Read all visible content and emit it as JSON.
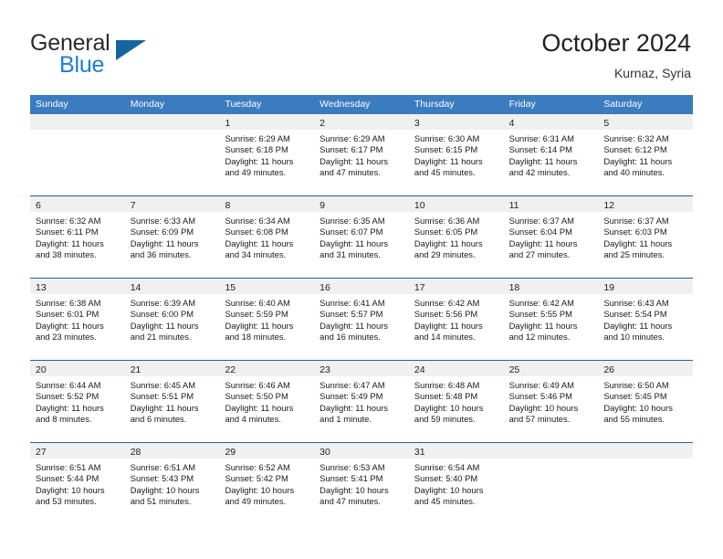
{
  "brand": {
    "name_primary": "General",
    "name_secondary": "Blue",
    "mark": "triangle-logo",
    "colors": {
      "primary_text": "#2b2b2b",
      "secondary_text": "#1b7fd4",
      "mark": "#15659e"
    }
  },
  "header": {
    "title": "October 2024",
    "subtitle": "Kurnaz, Syria"
  },
  "theme": {
    "header_row_bg": "#3b7cc0",
    "row_divider": "#2a6099",
    "day_band_bg": "#f0f0f0",
    "cell_bg": "#ffffff"
  },
  "calendar": {
    "weekdays": [
      "Sunday",
      "Monday",
      "Tuesday",
      "Wednesday",
      "Thursday",
      "Friday",
      "Saturday"
    ],
    "weeks": [
      [
        {
          "day": "",
          "lines": []
        },
        {
          "day": "",
          "lines": []
        },
        {
          "day": "1",
          "lines": [
            "Sunrise: 6:29 AM",
            "Sunset: 6:18 PM",
            "Daylight: 11 hours",
            "and 49 minutes."
          ]
        },
        {
          "day": "2",
          "lines": [
            "Sunrise: 6:29 AM",
            "Sunset: 6:17 PM",
            "Daylight: 11 hours",
            "and 47 minutes."
          ]
        },
        {
          "day": "3",
          "lines": [
            "Sunrise: 6:30 AM",
            "Sunset: 6:15 PM",
            "Daylight: 11 hours",
            "and 45 minutes."
          ]
        },
        {
          "day": "4",
          "lines": [
            "Sunrise: 6:31 AM",
            "Sunset: 6:14 PM",
            "Daylight: 11 hours",
            "and 42 minutes."
          ]
        },
        {
          "day": "5",
          "lines": [
            "Sunrise: 6:32 AM",
            "Sunset: 6:12 PM",
            "Daylight: 11 hours",
            "and 40 minutes."
          ]
        }
      ],
      [
        {
          "day": "6",
          "lines": [
            "Sunrise: 6:32 AM",
            "Sunset: 6:11 PM",
            "Daylight: 11 hours",
            "and 38 minutes."
          ]
        },
        {
          "day": "7",
          "lines": [
            "Sunrise: 6:33 AM",
            "Sunset: 6:09 PM",
            "Daylight: 11 hours",
            "and 36 minutes."
          ]
        },
        {
          "day": "8",
          "lines": [
            "Sunrise: 6:34 AM",
            "Sunset: 6:08 PM",
            "Daylight: 11 hours",
            "and 34 minutes."
          ]
        },
        {
          "day": "9",
          "lines": [
            "Sunrise: 6:35 AM",
            "Sunset: 6:07 PM",
            "Daylight: 11 hours",
            "and 31 minutes."
          ]
        },
        {
          "day": "10",
          "lines": [
            "Sunrise: 6:36 AM",
            "Sunset: 6:05 PM",
            "Daylight: 11 hours",
            "and 29 minutes."
          ]
        },
        {
          "day": "11",
          "lines": [
            "Sunrise: 6:37 AM",
            "Sunset: 6:04 PM",
            "Daylight: 11 hours",
            "and 27 minutes."
          ]
        },
        {
          "day": "12",
          "lines": [
            "Sunrise: 6:37 AM",
            "Sunset: 6:03 PM",
            "Daylight: 11 hours",
            "and 25 minutes."
          ]
        }
      ],
      [
        {
          "day": "13",
          "lines": [
            "Sunrise: 6:38 AM",
            "Sunset: 6:01 PM",
            "Daylight: 11 hours",
            "and 23 minutes."
          ]
        },
        {
          "day": "14",
          "lines": [
            "Sunrise: 6:39 AM",
            "Sunset: 6:00 PM",
            "Daylight: 11 hours",
            "and 21 minutes."
          ]
        },
        {
          "day": "15",
          "lines": [
            "Sunrise: 6:40 AM",
            "Sunset: 5:59 PM",
            "Daylight: 11 hours",
            "and 18 minutes."
          ]
        },
        {
          "day": "16",
          "lines": [
            "Sunrise: 6:41 AM",
            "Sunset: 5:57 PM",
            "Daylight: 11 hours",
            "and 16 minutes."
          ]
        },
        {
          "day": "17",
          "lines": [
            "Sunrise: 6:42 AM",
            "Sunset: 5:56 PM",
            "Daylight: 11 hours",
            "and 14 minutes."
          ]
        },
        {
          "day": "18",
          "lines": [
            "Sunrise: 6:42 AM",
            "Sunset: 5:55 PM",
            "Daylight: 11 hours",
            "and 12 minutes."
          ]
        },
        {
          "day": "19",
          "lines": [
            "Sunrise: 6:43 AM",
            "Sunset: 5:54 PM",
            "Daylight: 11 hours",
            "and 10 minutes."
          ]
        }
      ],
      [
        {
          "day": "20",
          "lines": [
            "Sunrise: 6:44 AM",
            "Sunset: 5:52 PM",
            "Daylight: 11 hours",
            "and 8 minutes."
          ]
        },
        {
          "day": "21",
          "lines": [
            "Sunrise: 6:45 AM",
            "Sunset: 5:51 PM",
            "Daylight: 11 hours",
            "and 6 minutes."
          ]
        },
        {
          "day": "22",
          "lines": [
            "Sunrise: 6:46 AM",
            "Sunset: 5:50 PM",
            "Daylight: 11 hours",
            "and 4 minutes."
          ]
        },
        {
          "day": "23",
          "lines": [
            "Sunrise: 6:47 AM",
            "Sunset: 5:49 PM",
            "Daylight: 11 hours",
            "and 1 minute."
          ]
        },
        {
          "day": "24",
          "lines": [
            "Sunrise: 6:48 AM",
            "Sunset: 5:48 PM",
            "Daylight: 10 hours",
            "and 59 minutes."
          ]
        },
        {
          "day": "25",
          "lines": [
            "Sunrise: 6:49 AM",
            "Sunset: 5:46 PM",
            "Daylight: 10 hours",
            "and 57 minutes."
          ]
        },
        {
          "day": "26",
          "lines": [
            "Sunrise: 6:50 AM",
            "Sunset: 5:45 PM",
            "Daylight: 10 hours",
            "and 55 minutes."
          ]
        }
      ],
      [
        {
          "day": "27",
          "lines": [
            "Sunrise: 6:51 AM",
            "Sunset: 5:44 PM",
            "Daylight: 10 hours",
            "and 53 minutes."
          ]
        },
        {
          "day": "28",
          "lines": [
            "Sunrise: 6:51 AM",
            "Sunset: 5:43 PM",
            "Daylight: 10 hours",
            "and 51 minutes."
          ]
        },
        {
          "day": "29",
          "lines": [
            "Sunrise: 6:52 AM",
            "Sunset: 5:42 PM",
            "Daylight: 10 hours",
            "and 49 minutes."
          ]
        },
        {
          "day": "30",
          "lines": [
            "Sunrise: 6:53 AM",
            "Sunset: 5:41 PM",
            "Daylight: 10 hours",
            "and 47 minutes."
          ]
        },
        {
          "day": "31",
          "lines": [
            "Sunrise: 6:54 AM",
            "Sunset: 5:40 PM",
            "Daylight: 10 hours",
            "and 45 minutes."
          ]
        },
        {
          "day": "",
          "lines": []
        },
        {
          "day": "",
          "lines": []
        }
      ]
    ]
  }
}
